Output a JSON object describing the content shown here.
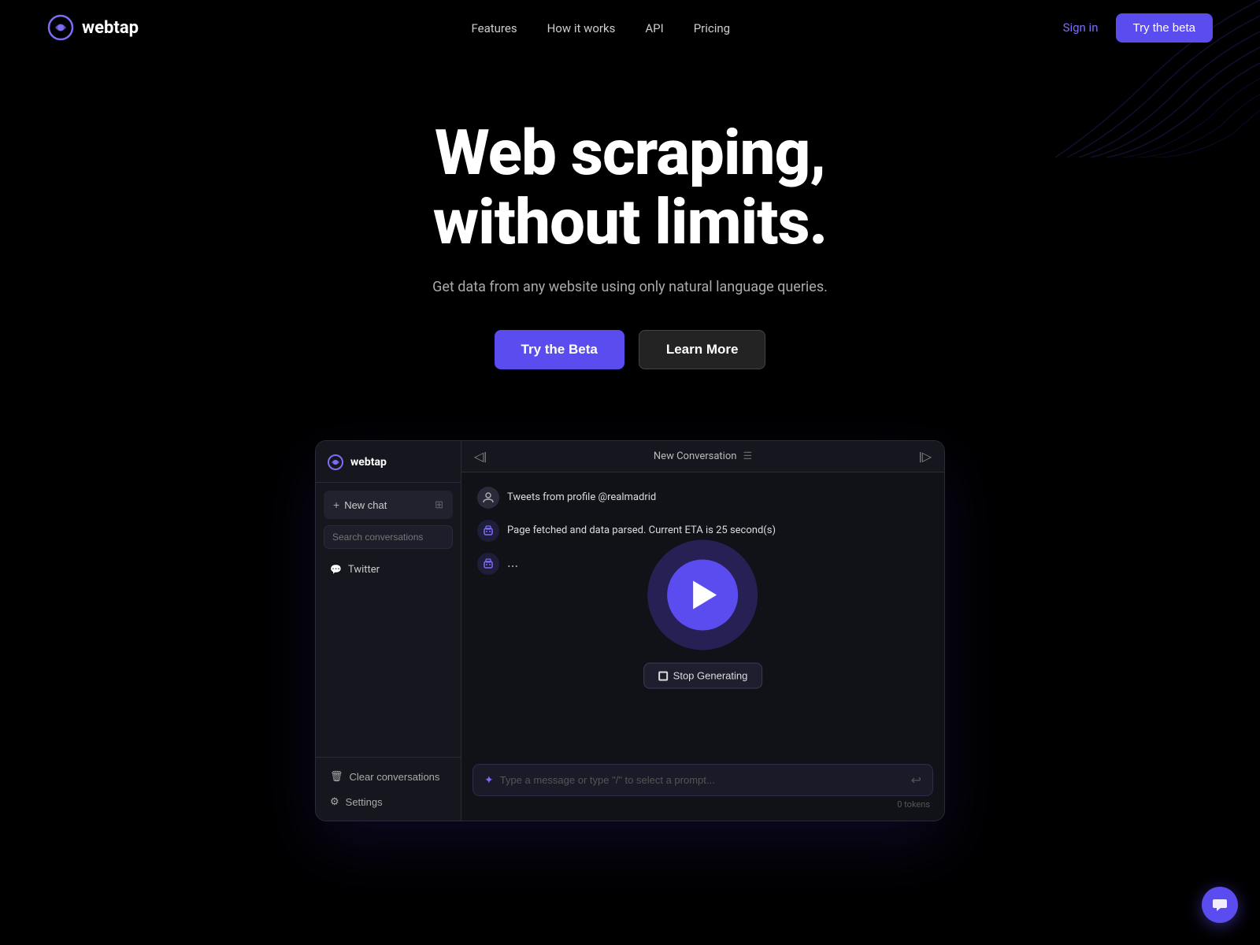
{
  "nav": {
    "logo_text": "webtap",
    "links": [
      {
        "label": "Features",
        "id": "features"
      },
      {
        "label": "How it works",
        "id": "how-it-works"
      },
      {
        "label": "API",
        "id": "api"
      },
      {
        "label": "Pricing",
        "id": "pricing"
      }
    ],
    "signin_label": "Sign in",
    "try_beta_label": "Try the beta"
  },
  "hero": {
    "headline_line1": "Web scraping,",
    "headline_line2": "without limits.",
    "subheadline": "Get data from any website using only natural language queries.",
    "btn_try_beta": "Try the Beta",
    "btn_learn_more": "Learn More"
  },
  "demo": {
    "sidebar": {
      "logo_text": "webtap",
      "new_chat_label": "New chat",
      "search_placeholder": "Search conversations",
      "conversations": [
        {
          "label": "Twitter",
          "id": "twitter"
        }
      ],
      "bottom_items": [
        {
          "label": "Clear conversations",
          "icon": "trash"
        },
        {
          "label": "Settings",
          "icon": "gear"
        }
      ]
    },
    "chat": {
      "header_title": "New Conversation",
      "messages": [
        {
          "type": "user",
          "content": "Tweets from profile @realmadrid"
        },
        {
          "type": "bot",
          "content": "Page fetched and data parsed. Current ETA is 25 second(s)"
        },
        {
          "type": "bot",
          "content": "..."
        }
      ],
      "stop_generating_label": "Stop Generating",
      "input_placeholder": "Type a message or type \"/\" to select a prompt...",
      "tokens_label": "0 tokens"
    }
  }
}
